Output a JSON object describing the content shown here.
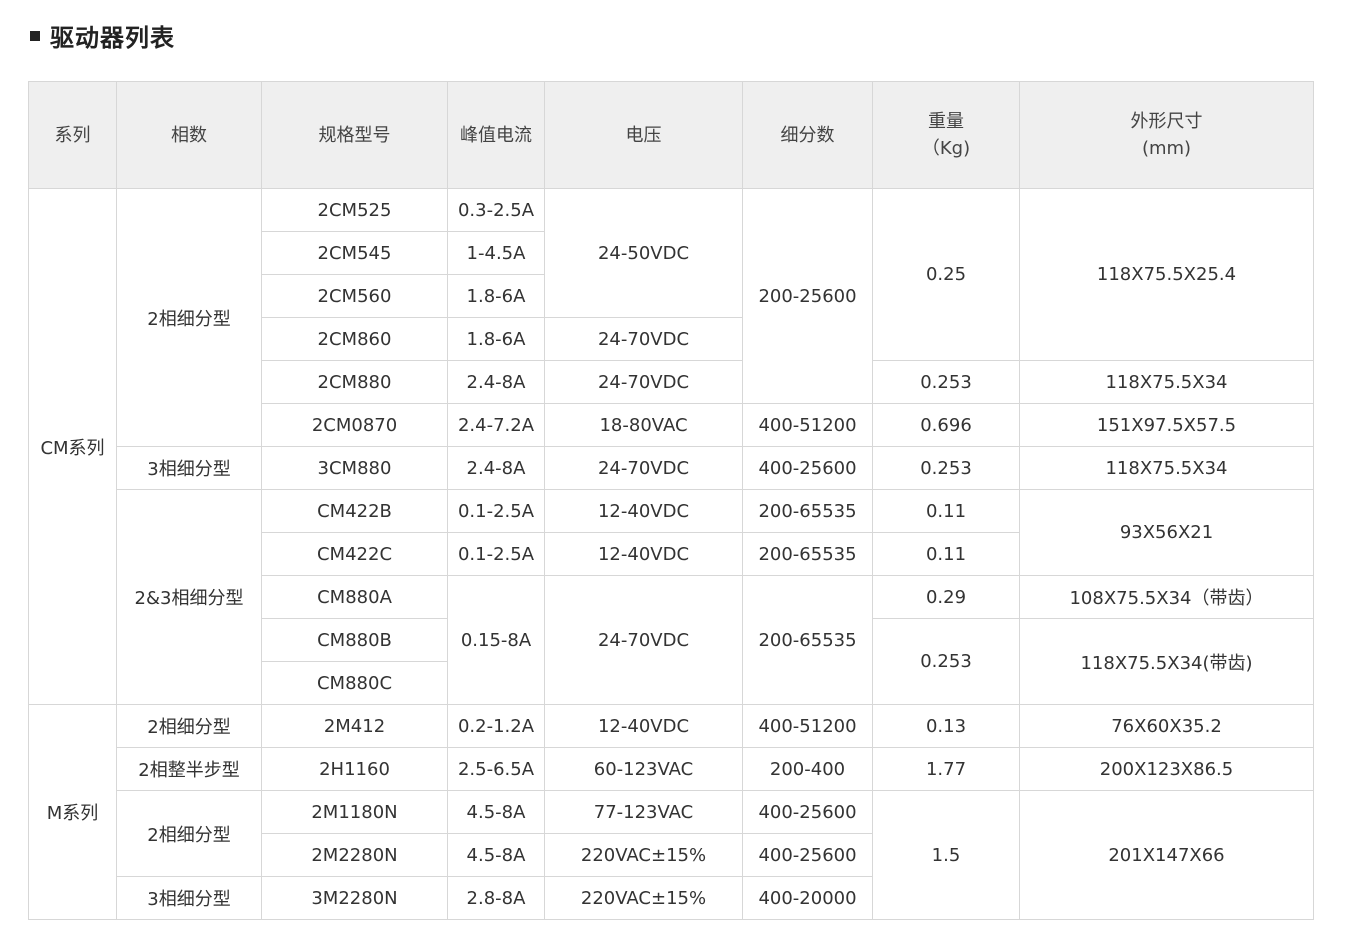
{
  "title": "驱动器列表",
  "headers": {
    "series": "系列",
    "phase": "相数",
    "model": "规格型号",
    "peak_current": "峰值电流",
    "voltage": "电压",
    "microstep": "细分数",
    "weight_l1": "重量",
    "weight_l2": "（Kg)",
    "dims_l1": "外形尺寸",
    "dims_l2": "(mm)"
  },
  "groups": {
    "cm": "CM系列",
    "m": "M系列"
  },
  "phases": {
    "p1": "2相细分型",
    "p2": "3相细分型",
    "p3": "2&3相细分型",
    "p4": "2相细分型",
    "p5": "2相整半步型",
    "p6": "2相细分型",
    "p7": "3相细分型"
  },
  "rows": [
    {
      "model": "2CM525",
      "current": "0.3-2.5A",
      "voltage": "24-50VDC",
      "microstep": "200-25600",
      "weight": "0.25",
      "dims": "118X75.5X25.4"
    },
    {
      "model": "2CM545",
      "current": "1-4.5A"
    },
    {
      "model": "2CM560",
      "current": "1.8-6A"
    },
    {
      "model": "2CM860",
      "current": "1.8-6A",
      "voltage": "24-70VDC"
    },
    {
      "model": "2CM880",
      "current": "2.4-8A",
      "voltage": "24-70VDC",
      "weight": "0.253",
      "dims": "118X75.5X34"
    },
    {
      "model": "2CM0870",
      "current": "2.4-7.2A",
      "voltage": "18-80VAC",
      "microstep": "400-51200",
      "weight": "0.696",
      "dims": "151X97.5X57.5"
    },
    {
      "model": "3CM880",
      "current": "2.4-8A",
      "voltage": "24-70VDC",
      "microstep": "400-25600",
      "weight": "0.253",
      "dims": "118X75.5X34"
    },
    {
      "model": "CM422B",
      "current": "0.1-2.5A",
      "voltage": "12-40VDC",
      "microstep": "200-65535",
      "weight": "0.11",
      "dims": "93X56X21"
    },
    {
      "model": "CM422C",
      "current": "0.1-2.5A",
      "voltage": "12-40VDC",
      "microstep": "200-65535",
      "weight": "0.11"
    },
    {
      "model": "CM880A",
      "current": "0.15-8A",
      "voltage": "24-70VDC",
      "microstep": "200-65535",
      "weight": "0.29",
      "dims": "108X75.5X34（带齿）"
    },
    {
      "model": "CM880B",
      "weight": "0.253",
      "dims": "118X75.5X34(带齿)"
    },
    {
      "model": "CM880C"
    },
    {
      "model": "2M412",
      "current": "0.2-1.2A",
      "voltage": "12-40VDC",
      "microstep": "400-51200",
      "weight": "0.13",
      "dims": "76X60X35.2"
    },
    {
      "model": "2H1160",
      "current": "2.5-6.5A",
      "voltage": "60-123VAC",
      "microstep": "200-400",
      "weight": "1.77",
      "dims": "200X123X86.5"
    },
    {
      "model": "2M1180N",
      "current": "4.5-8A",
      "voltage": "77-123VAC",
      "microstep": "400-25600",
      "weight": "1.5",
      "dims": "201X147X66"
    },
    {
      "model": "2M2280N",
      "current": "4.5-8A",
      "voltage": "220VAC±15%",
      "microstep": "400-25600"
    },
    {
      "model": "3M2280N",
      "current": "2.8-8A",
      "voltage": "220VAC±15%",
      "microstep": "400-20000"
    }
  ]
}
